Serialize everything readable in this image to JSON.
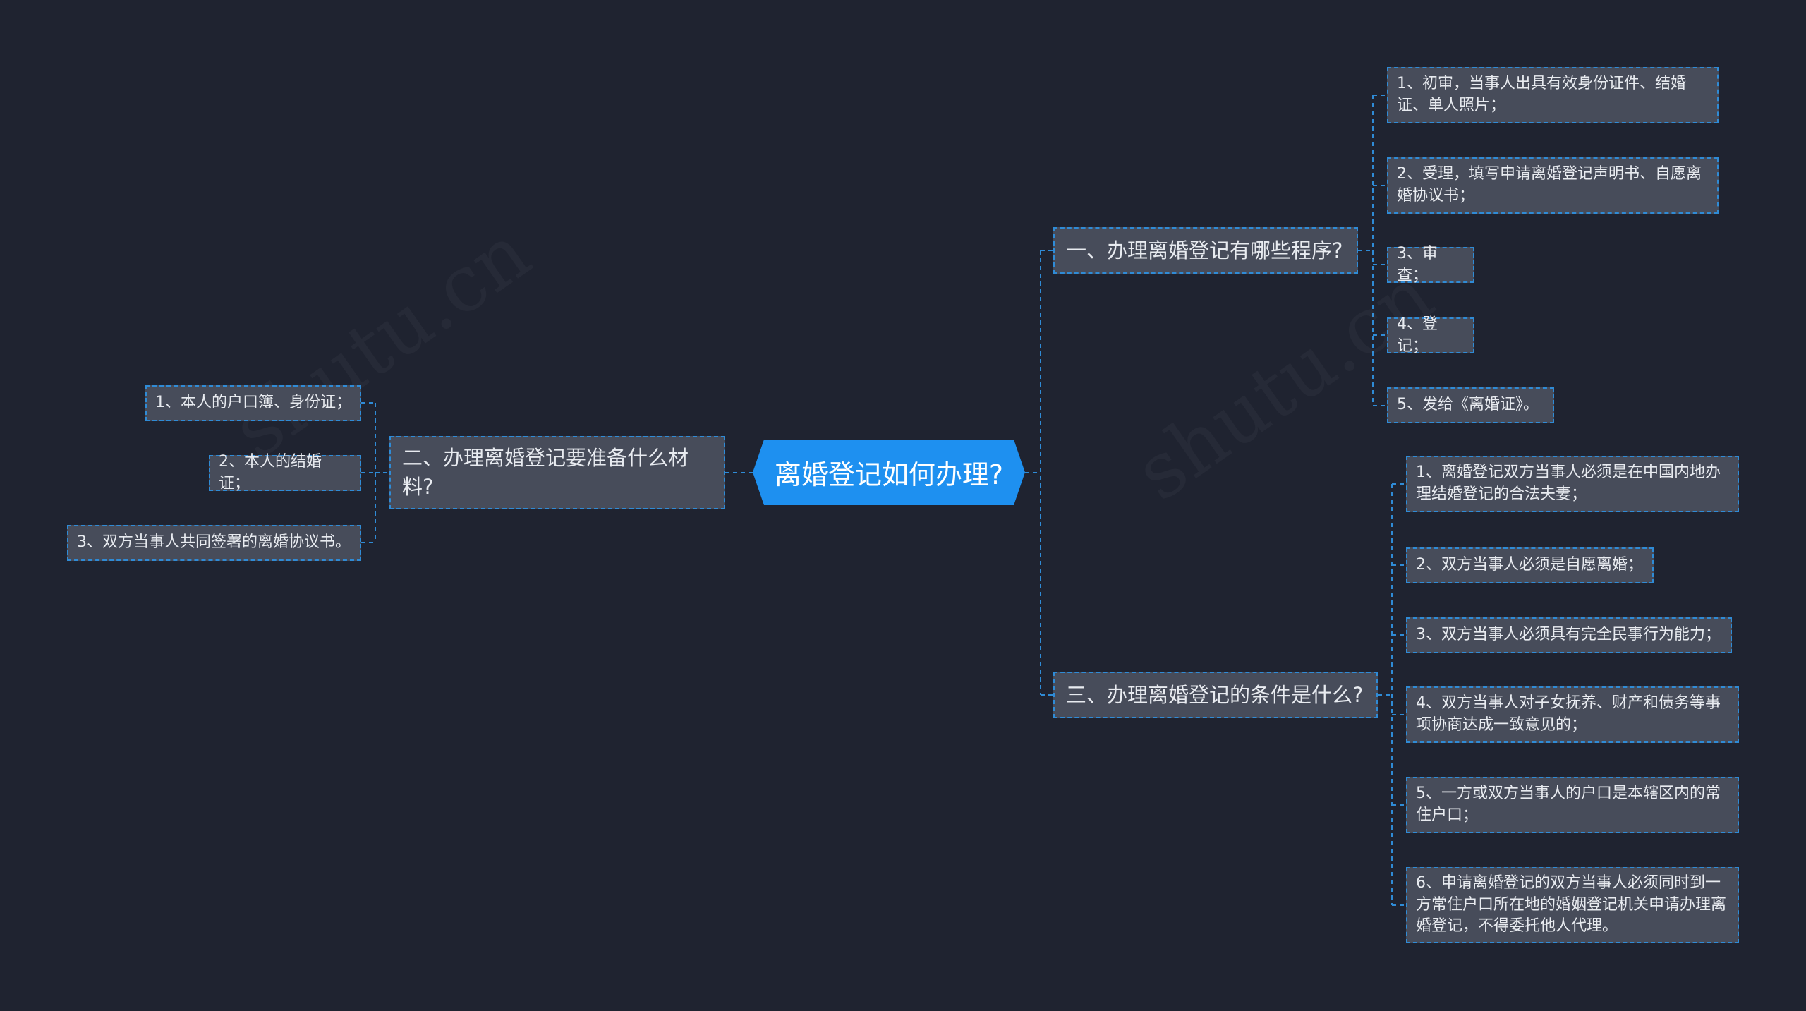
{
  "root": {
    "label": "离婚登记如何办理?"
  },
  "branches": [
    {
      "label": "一、办理离婚登记有哪些程序?",
      "children": [
        "1、初审，当事人出具有效身份证件、结婚证、单人照片；",
        "2、受理，填写申请离婚登记声明书、自愿离婚协议书；",
        "3、审查；",
        "4、登记；",
        "5、发给《离婚证》。"
      ]
    },
    {
      "label": "二、办理离婚登记要准备什么材料?",
      "children": [
        "1、本人的户口簿、身份证；",
        "2、本人的结婚证；",
        "3、双方当事人共同签署的离婚协议书。"
      ]
    },
    {
      "label": "三、办理离婚登记的条件是什么?",
      "children": [
        "1、离婚登记双方当事人必须是在中国内地办理结婚登记的合法夫妻；",
        "2、双方当事人必须是自愿离婚；",
        "3、双方当事人必须具有完全民事行为能力；",
        "4、双方当事人对子女抚养、财产和债务等事项协商达成一致意见的；",
        "5、一方或双方当事人的户口是本辖区内的常住户口；",
        "6、申请离婚登记的双方当事人必须同时到一方常住户口所在地的婚姻登记机关申请办理离婚登记，不得委托他人代理。"
      ]
    }
  ],
  "colors": {
    "background": "#1f2330",
    "root_fill": "#1e90f0",
    "node_fill": "#474c5a",
    "link": "#2f8bd6"
  }
}
